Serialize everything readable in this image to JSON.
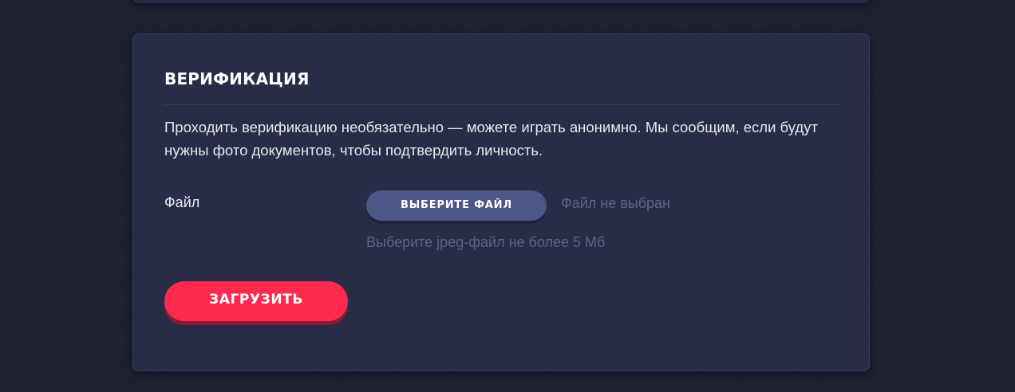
{
  "verification": {
    "title": "ВЕРИФИКАЦИЯ",
    "description": "Проходить верификацию необязательно — можете играть анонимно. Мы сообщим, если будут нужны фото документов, чтобы подтвердить личность.",
    "file_label": "Файл",
    "choose_file_label": "ВЫБЕРИТЕ ФАЙЛ",
    "file_status": "Файл не выбран",
    "file_hint": "Выберите jpeg-файл не более 5 Мб",
    "upload_label": "ЗАГРУЗИТЬ"
  },
  "colors": {
    "background": "#1d1f33",
    "card": "#282c46",
    "choose_button": "#4d5686",
    "upload_button": "#ff2a4d",
    "muted_text": "#5e6586"
  }
}
